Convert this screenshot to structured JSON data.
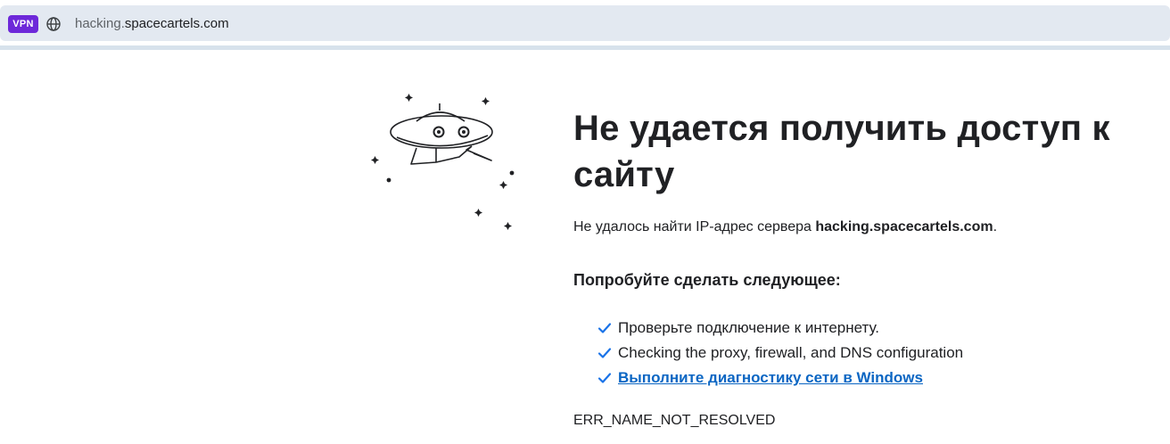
{
  "address_bar": {
    "vpn_badge": "VPN",
    "url_prefix": "hacking.",
    "url_domain": "spacecartels.com",
    "icon": "globe-icon"
  },
  "error_page": {
    "title": "Не удается получить доступ к сайту",
    "description_prefix": "Не удалось найти IP-адрес сервера ",
    "description_host": "hacking.spacecartels.com",
    "description_suffix": ".",
    "try_heading": "Попробуйте сделать следующее:",
    "suggestions": [
      "Проверьте подключение к интернету.",
      "Checking the proxy, firewall, and DNS configuration",
      "Выполните диагностику сети в Windows"
    ],
    "error_code": "ERR_NAME_NOT_RESOLVED",
    "illustration_icon": "ufo-icon",
    "check_icon": "checkmark-icon"
  },
  "colors": {
    "vpn_badge": "#6d28d9",
    "address_bar_bg": "#e3e9f1",
    "check": "#1a73e8",
    "link": "#0b66c3"
  }
}
